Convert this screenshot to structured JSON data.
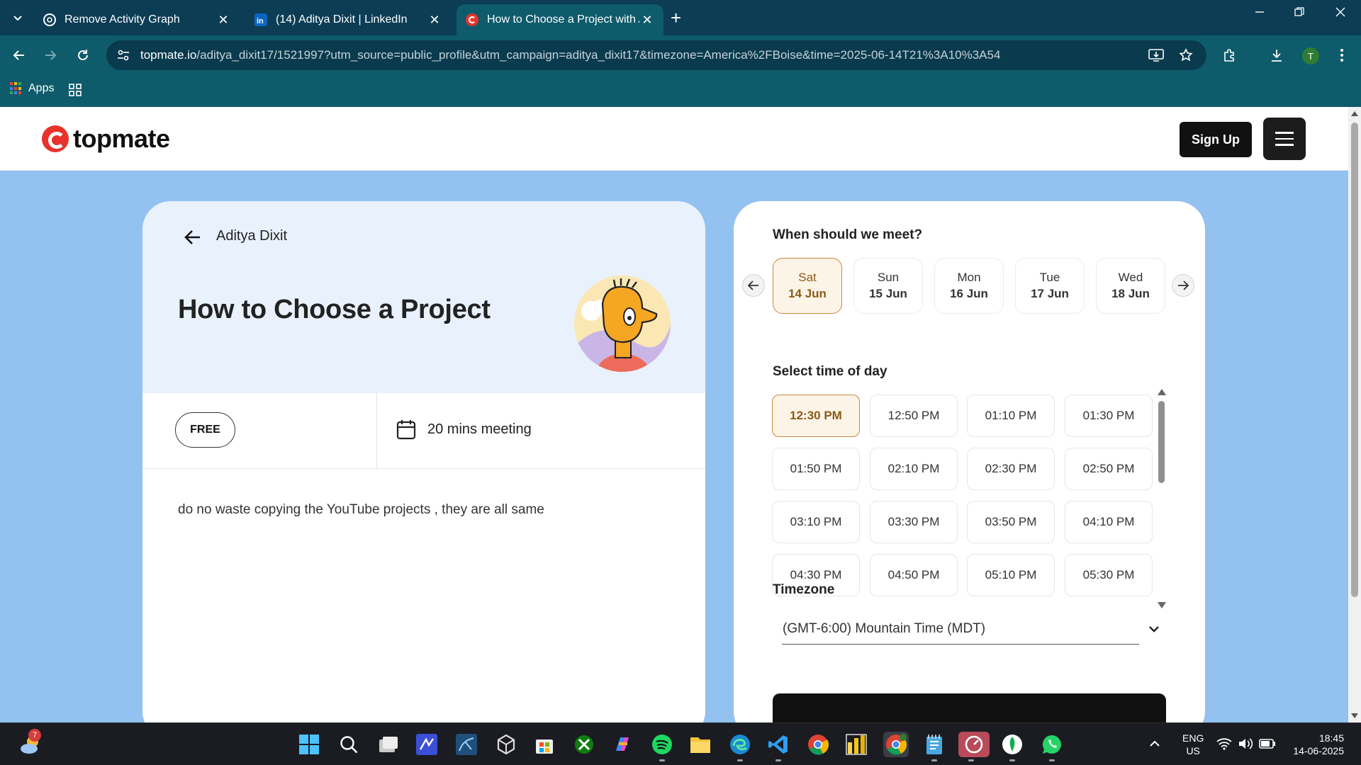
{
  "browser": {
    "tabs": [
      {
        "title": "Remove Activity Graph",
        "active": false
      },
      {
        "title": "(14) Aditya Dixit | LinkedIn",
        "active": false
      },
      {
        "title": "How to Choose a Project with A",
        "active": true
      }
    ],
    "new_tab": "+",
    "url_host": "topmate.io",
    "url_path": "/aditya_dixit17/1521997?utm_source=public_profile&utm_campaign=aditya_dixit17&timezone=America%2FBoise&time=2025-06-14T21%3A10%3A54",
    "profile_initial": "T",
    "bookmarks": {
      "apps_label": "Apps"
    }
  },
  "site": {
    "logo_text": "topmate",
    "signup_label": "Sign Up"
  },
  "service": {
    "host_name": "Aditya Dixit",
    "title": "How to Choose a Project",
    "price": "FREE",
    "duration": "20 mins meeting",
    "description": "do no waste copying the YouTube projects , they are all same"
  },
  "booking": {
    "date_heading": "When should we meet?",
    "dates": [
      {
        "weekday": "Sat",
        "date": "14 Jun",
        "selected": true
      },
      {
        "weekday": "Sun",
        "date": "15 Jun",
        "selected": false
      },
      {
        "weekday": "Mon",
        "date": "16 Jun",
        "selected": false
      },
      {
        "weekday": "Tue",
        "date": "17 Jun",
        "selected": false
      },
      {
        "weekday": "Wed",
        "date": "18 Jun",
        "selected": false
      }
    ],
    "time_heading": "Select time of day",
    "slots": [
      "12:30 PM",
      "12:50 PM",
      "01:10 PM",
      "01:30 PM",
      "01:50 PM",
      "02:10 PM",
      "02:30 PM",
      "02:50 PM",
      "03:10 PM",
      "03:30 PM",
      "03:50 PM",
      "04:10 PM",
      "04:30 PM",
      "04:50 PM",
      "05:10 PM",
      "05:30 PM"
    ],
    "selected_slot": "12:30 PM",
    "timezone_heading": "Timezone",
    "timezone_value": "(GMT-6:00) Mountain Time (MDT)"
  },
  "colors": {
    "page_bg": "#93c1f0",
    "accent_selected": "#c8893a",
    "brand_red": "#e8322c",
    "chrome_bg": "#0e5b6b"
  },
  "taskbar": {
    "weather_badge": "7",
    "lang_line1": "ENG",
    "lang_line2": "US",
    "time": "18:45",
    "date": "14-06-2025",
    "apps": [
      "windows-start-icon",
      "search-icon",
      "task-view-icon",
      "vscode-insiders-icon",
      "mysql-workbench-icon",
      "unity-icon",
      "microsoft-store-icon",
      "xbox-icon",
      "copilot-icon",
      "spotify-icon",
      "file-explorer-icon",
      "edge-icon",
      "vscode-icon",
      "chrome-icon",
      "power-bi-icon",
      "chrome-profile-icon",
      "notepad-icon",
      "topmate-app-icon",
      "mongodb-compass-icon",
      "whatsapp-icon"
    ]
  }
}
